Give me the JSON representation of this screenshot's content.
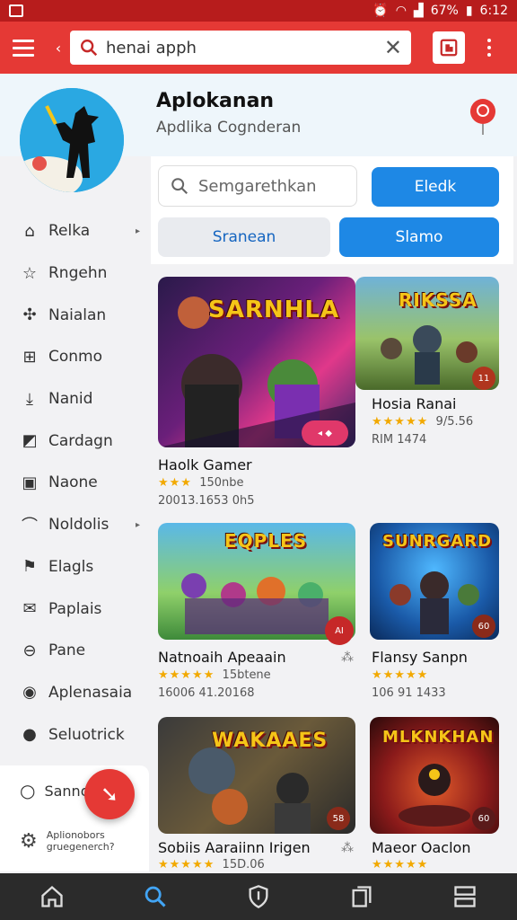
{
  "status": {
    "battery": "67%",
    "time": "6:12"
  },
  "search": {
    "value": "henai apph"
  },
  "header": {
    "title": "Aplokanan",
    "subtitle": "Apdlika Cognderan"
  },
  "panel": {
    "search_placeholder": "Semgarethkan",
    "btn_primary": "Eledk",
    "btn_secondary": "Sranean",
    "btn_tertiary": "Slamo"
  },
  "sidebar": {
    "items": [
      {
        "label": "Relka",
        "icon": "home-icon"
      },
      {
        "label": "Rngehn",
        "icon": "star-outline-icon"
      },
      {
        "label": "Naialan",
        "icon": "puzzle-icon"
      },
      {
        "label": "Conmo",
        "icon": "grid-icon"
      },
      {
        "label": "Nanid",
        "icon": "download-tray-icon"
      },
      {
        "label": "Cardagn",
        "icon": "image-icon"
      },
      {
        "label": "Naone",
        "icon": "id-icon"
      },
      {
        "label": "Noldolis",
        "icon": "signal-icon"
      },
      {
        "label": "Elagls",
        "icon": "flag-icon"
      },
      {
        "label": "Paplais",
        "icon": "envelope-icon"
      },
      {
        "label": "Pane",
        "icon": "minus-box-icon"
      },
      {
        "label": "Aplenasaia",
        "icon": "location-icon"
      },
      {
        "label": "Seluotrick",
        "icon": "person-icon"
      }
    ],
    "footer": [
      {
        "label": "Sanno",
        "icon": "chat-icon"
      },
      {
        "label": "Aplionobors gruegenerch?",
        "icon": "settings-icon"
      }
    ]
  },
  "cards": [
    {
      "banner": "SARNHLA",
      "title": "Haolk Gamer",
      "stars": "★★★",
      "rating": "150nbe",
      "meta": "20013.1653 0h5"
    },
    {
      "banner": "RIKSSA",
      "title": "Hosia Ranai",
      "stars": "★★★★★",
      "rating": "9/5.56",
      "meta": "RIM 1474",
      "badge": "11"
    },
    {
      "banner": "EQPLES",
      "title": "Natnoaih Apeaain",
      "stars": "★★★★★",
      "rating": "15btene",
      "meta": "16006 41.20168",
      "badge": "AI"
    },
    {
      "banner": "SUNRGARD",
      "title": "Flansy Sanpn",
      "stars": "★★★★★",
      "rating": "",
      "meta": "106 91 1433",
      "badge": "60"
    },
    {
      "banner": "WAKAAES",
      "title": "Sobiis Aaraiinn Irigen",
      "stars": "★★★★★",
      "rating": "15D.06",
      "meta": "",
      "badge": "58"
    },
    {
      "banner": "MLKNKHAN",
      "title": "Maeor Oaclon",
      "stars": "★★★★★",
      "rating": "",
      "meta": "",
      "badge": "60"
    }
  ]
}
